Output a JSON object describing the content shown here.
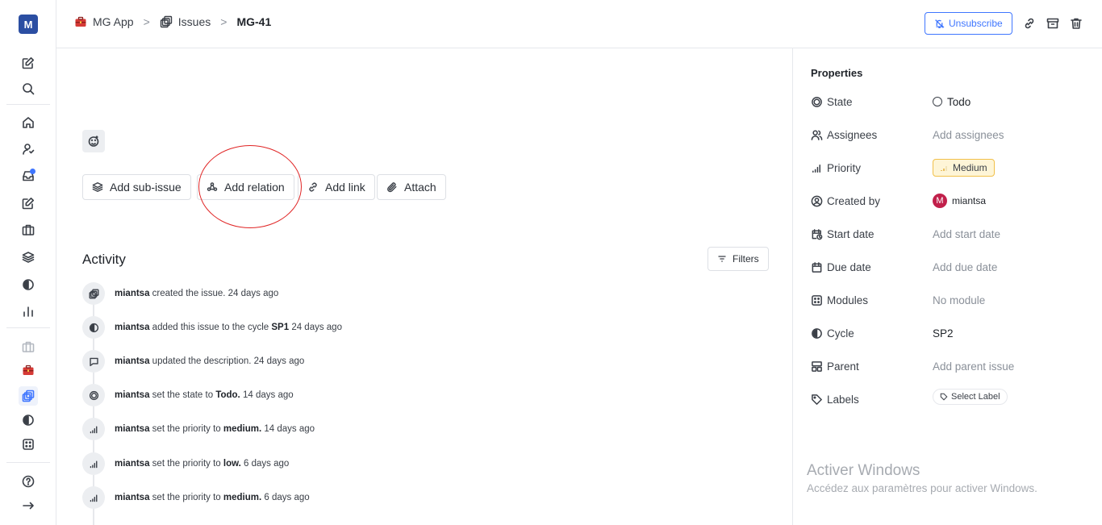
{
  "workspace": {
    "initial": "M"
  },
  "breadcrumb": {
    "project": "MG App",
    "section": "Issues",
    "issue": "MG-41",
    "separator": ">"
  },
  "header": {
    "unsubscribe_label": "Unsubscribe"
  },
  "actions": {
    "add_sub_issue": "Add sub-issue",
    "add_relation": "Add relation",
    "add_link": "Add link",
    "attach": "Attach"
  },
  "activity": {
    "title": "Activity",
    "filters_label": "Filters",
    "items": [
      {
        "icon": "issue-icon",
        "user": "miantsa",
        "text": "created the issue.",
        "strong": "",
        "time": "24 days ago"
      },
      {
        "icon": "cycle-icon",
        "user": "miantsa",
        "text": "added this issue to the cycle",
        "strong": "SP1",
        "time": "24 days ago"
      },
      {
        "icon": "comment-icon",
        "user": "miantsa",
        "text": "updated the description.",
        "strong": "",
        "time": "24 days ago"
      },
      {
        "icon": "state-icon",
        "user": "miantsa",
        "text": "set the state to",
        "strong": "Todo.",
        "time": "14 days ago"
      },
      {
        "icon": "priority-icon",
        "user": "miantsa",
        "text": "set the priority to",
        "strong": "medium.",
        "time": "14 days ago"
      },
      {
        "icon": "priority-icon",
        "user": "miantsa",
        "text": "set the priority to",
        "strong": "low.",
        "time": "6 days ago"
      },
      {
        "icon": "priority-icon",
        "user": "miantsa",
        "text": "set the priority to",
        "strong": "medium.",
        "time": "6 days ago"
      }
    ]
  },
  "properties": {
    "title": "Properties",
    "state": {
      "label": "State",
      "value": "Todo"
    },
    "assignees": {
      "label": "Assignees",
      "value": "Add assignees"
    },
    "priority": {
      "label": "Priority",
      "value": "Medium"
    },
    "created_by": {
      "label": "Created by",
      "avatar_initial": "M",
      "value": "miantsa"
    },
    "start_date": {
      "label": "Start date",
      "value": "Add start date"
    },
    "due_date": {
      "label": "Due date",
      "value": "Add due date"
    },
    "modules": {
      "label": "Modules",
      "value": "No module"
    },
    "cycle": {
      "label": "Cycle",
      "value": "SP2"
    },
    "parent": {
      "label": "Parent",
      "value": "Add parent issue"
    },
    "labels": {
      "label": "Labels",
      "value": "Select Label"
    }
  },
  "watermark": {
    "title": "Activer Windows",
    "subtitle": "Accédez aux paramètres pour activer Windows."
  },
  "colors": {
    "accent": "#3f76ff",
    "annotation_circle": "#e02424",
    "priority_medium_bg": "#fef5d7",
    "avatar": "#c1204b"
  }
}
